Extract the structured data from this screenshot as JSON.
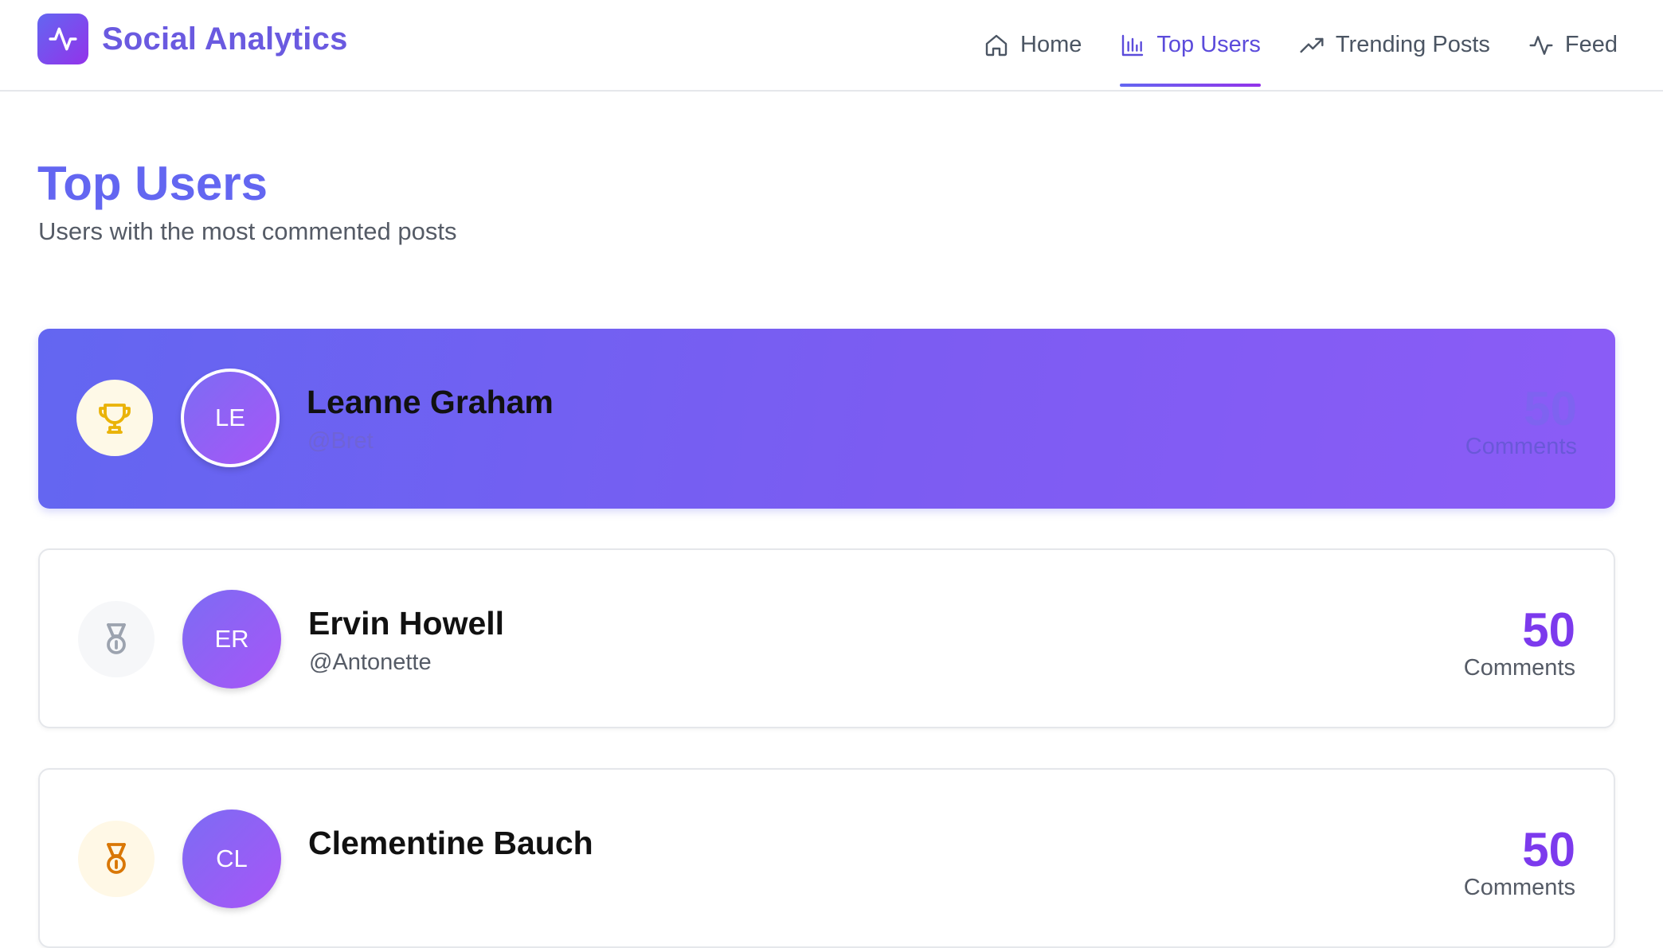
{
  "app": {
    "title": "Social Analytics",
    "logo_icon": "activity-pulse-icon",
    "brand_colors": {
      "primary": "#6366f1",
      "secondary": "#9333ea"
    }
  },
  "nav": {
    "items": [
      {
        "label": "Home",
        "icon": "home-icon",
        "active": false
      },
      {
        "label": "Top Users",
        "icon": "bar-chart-icon",
        "active": true
      },
      {
        "label": "Trending Posts",
        "icon": "trending-up-icon",
        "active": false
      },
      {
        "label": "Feed",
        "icon": "activity-icon",
        "active": false
      }
    ]
  },
  "page": {
    "title": "Top Users",
    "subtitle": "Users with the most commented posts"
  },
  "users": [
    {
      "rank_icon": "trophy-icon",
      "initials": "LE",
      "name": "Leanne Graham",
      "handle": "@Bret",
      "count": "50",
      "count_label": "Comments"
    },
    {
      "rank_icon": "medal-icon",
      "initials": "ER",
      "name": "Ervin Howell",
      "handle": "@Antonette",
      "count": "50",
      "count_label": "Comments"
    },
    {
      "rank_icon": "award-icon",
      "initials": "CL",
      "name": "Clementine Bauch",
      "handle": "",
      "count": "50",
      "count_label": "Comments"
    }
  ]
}
